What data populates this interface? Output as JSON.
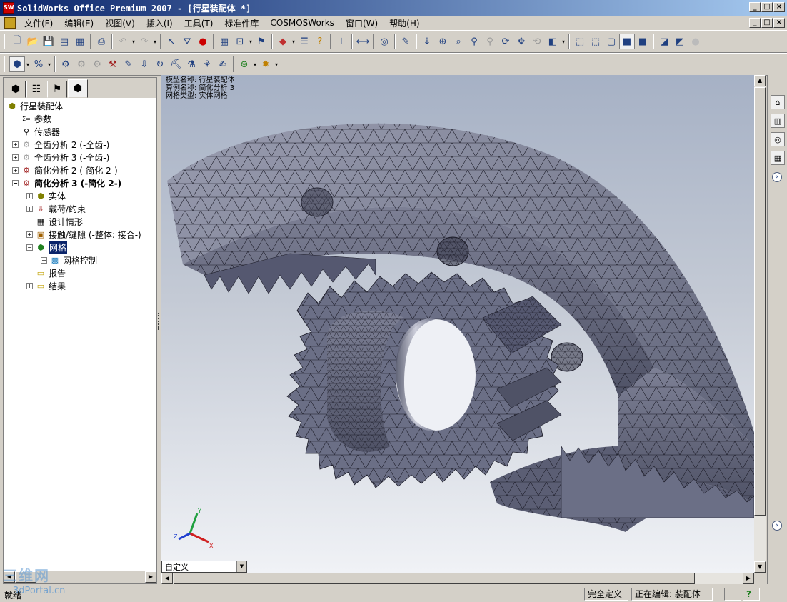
{
  "window": {
    "title": "SolidWorks Office Premium 2007 - [行星装配体 *]",
    "controls": [
      "_",
      "□",
      "×"
    ]
  },
  "menu": {
    "items": [
      "文件(F)",
      "编辑(E)",
      "视图(V)",
      "插入(I)",
      "工具(T)",
      "标准件库",
      "COSMOSWorks",
      "窗口(W)",
      "帮助(H)"
    ]
  },
  "tree": {
    "root": "行星装配体",
    "items": [
      {
        "label": "参数",
        "icon": "parameters-icon",
        "bold": false
      },
      {
        "label": "传感器",
        "icon": "sensor-icon",
        "bold": false
      },
      {
        "label": "全齿分析 2 (-全齿-)",
        "icon": "study-icon",
        "bold": false
      },
      {
        "label": "全齿分析 3 (-全齿-)",
        "icon": "study-icon",
        "bold": false
      },
      {
        "label": "简化分析  2 (-简化  2-)",
        "icon": "study-icon",
        "bold": false
      },
      {
        "label": "简化分析  3 (-简化  2-)",
        "icon": "study-icon",
        "bold": true
      },
      {
        "label": "实体",
        "icon": "solids-icon",
        "bold": false
      },
      {
        "label": "载荷/约束",
        "icon": "loads-icon",
        "bold": false
      },
      {
        "label": "设计情形",
        "icon": "design-scenario-icon",
        "bold": false
      },
      {
        "label": "接触/缝隙 (-整体: 接合-)",
        "icon": "contact-icon",
        "bold": false
      },
      {
        "label": "网格",
        "icon": "mesh-icon",
        "bold": false
      },
      {
        "label": "网格控制",
        "icon": "mesh-control-icon",
        "bold": false
      },
      {
        "label": "报告",
        "icon": "report-folder-icon",
        "bold": false
      },
      {
        "label": "结果",
        "icon": "results-folder-icon",
        "bold": false
      }
    ]
  },
  "viewport": {
    "info": [
      "模型名称: 行星装配体",
      "算例名称: 简化分析  3",
      "网格类型: 实体网格"
    ],
    "triad": {
      "x": "X",
      "y": "Y",
      "z": "Z"
    }
  },
  "view_combo": {
    "value": "自定义"
  },
  "status": {
    "ready": "就绪",
    "defined": "完全定义",
    "editing": "正在编辑: 装配体",
    "help": "?"
  },
  "watermark": {
    "top": "三维网",
    "bottom": "3dPortal.cn"
  },
  "colors": {
    "mesh_fill": "#6b6f86",
    "mesh_lines": "#1c1c28",
    "title_gradient_start": "#0a246a",
    "title_gradient_end": "#a6caf0",
    "selection": "#0a246a"
  }
}
